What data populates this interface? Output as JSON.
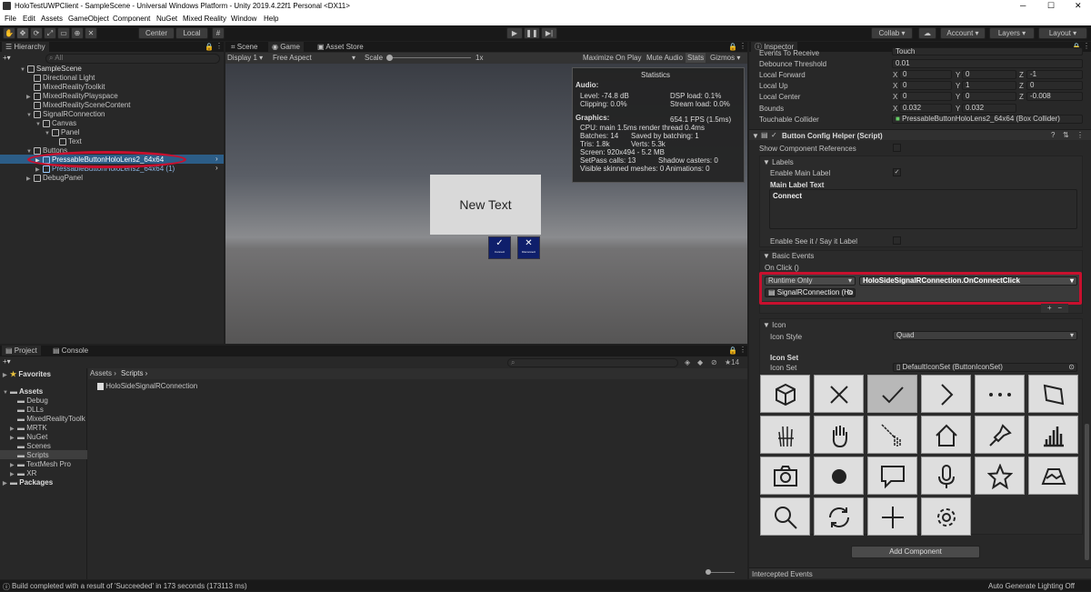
{
  "titlebar": {
    "title": "HoloTestUWPClient - SampleScene - Universal Windows Platform - Unity 2019.4.22f1 Personal <DX11>"
  },
  "menu": [
    "File",
    "Edit",
    "Assets",
    "GameObject",
    "Component",
    "NuGet",
    "Mixed Reality",
    "Window",
    "Help"
  ],
  "toolbar": {
    "center": "Center",
    "local": "Local",
    "collab": "Collab",
    "account": "Account",
    "layers": "Layers",
    "layout": "Layout"
  },
  "hierarchy": {
    "tab": "Hierarchy",
    "search_placeholder": "All",
    "items": [
      {
        "label": "SampleScene",
        "indent": 0
      },
      {
        "label": "Directional Light",
        "indent": 1
      },
      {
        "label": "MixedRealityToolkit",
        "indent": 1
      },
      {
        "label": "MixedRealityPlayspace",
        "indent": 1
      },
      {
        "label": "MixedRealitySceneContent",
        "indent": 1
      },
      {
        "label": "SignalRConnection",
        "indent": 1
      },
      {
        "label": "Canvas",
        "indent": 2
      },
      {
        "label": "Panel",
        "indent": 3
      },
      {
        "label": "Text",
        "indent": 4
      },
      {
        "label": "Buttons",
        "indent": 1
      },
      {
        "label": "PressableButtonHoloLens2_64x64",
        "indent": 2
      },
      {
        "label": "PressableButtonHoloLens2_64x64 (1)",
        "indent": 2
      },
      {
        "label": "DebugPanel",
        "indent": 1
      }
    ]
  },
  "game": {
    "tabs": [
      "Scene",
      "Game",
      "Asset Store"
    ],
    "display": "Display 1",
    "aspect": "Free Aspect",
    "scale_label": "Scale",
    "scale_value": "1x",
    "maximize": "Maximize On Play",
    "mute": "Mute Audio",
    "stats": "Stats",
    "gizmos": "Gizmos",
    "new_text": "New Text",
    "btn1": "Connect",
    "btn2": "Disconnect"
  },
  "stats_panel": {
    "title": "Statistics",
    "audio": "Audio:",
    "level": "Level: -74.8 dB",
    "clipping": "Clipping: 0.0%",
    "dsp": "DSP load: 0.1%",
    "stream": "Stream load: 0.0%",
    "graphics": "Graphics:",
    "fps": "654.1 FPS (1.5ms)",
    "cpu": "CPU: main 1.5ms  render thread 0.4ms",
    "batches": "Batches: 14",
    "saved": "Saved by batching: 1",
    "tris": "Tris: 1.8k",
    "verts": "Verts: 5.3k",
    "screen": "Screen: 920x494 - 5.2 MB",
    "setpass": "SetPass calls: 13",
    "shadow": "Shadow casters: 0",
    "skinned": "Visible skinned meshes: 0  Animations: 0"
  },
  "project": {
    "tabs": [
      "Project",
      "Console"
    ],
    "count": "14",
    "favorites": "Favorites",
    "assets": "Assets",
    "folders": [
      "Debug",
      "DLLs",
      "MixedRealityToolk",
      "MRTK",
      "NuGet",
      "Scenes",
      "Scripts",
      "TextMesh Pro",
      "XR"
    ],
    "packages": "Packages",
    "breadcrumb1": "Assets",
    "breadcrumb2": "Scripts",
    "file": "HoloSideSignalRConnection"
  },
  "inspector": {
    "tab": "Inspector",
    "events_to_receive": "Events To Receive",
    "events_value": "Touch",
    "debounce": "Debounce Threshold",
    "debounce_value": "0.01",
    "fwd": "Local Forward",
    "fwd_vals": [
      "0",
      "0",
      "-1"
    ],
    "up": "Local Up",
    "up_vals": [
      "0",
      "1",
      "0"
    ],
    "center": "Local Center",
    "center_vals": [
      "0",
      "0",
      "-0.008"
    ],
    "bounds": "Bounds",
    "bounds_vals": [
      "0.032",
      "0.032"
    ],
    "collider": "Touchable Collider",
    "collider_value": "PressableButtonHoloLens2_64x64 (Box Collider)",
    "component": "Button Config Helper (Script)",
    "show_refs": "Show Component References",
    "labels": "Labels",
    "enable_main": "Enable Main Label",
    "main_label_text": "Main Label Text",
    "main_label_value": "Connect",
    "enable_see": "Enable See it / Say it Label",
    "basic_events": "Basic Events",
    "onclick": "On Click ()",
    "runtime": "Runtime Only",
    "func": "HoloSideSignalRConnection.OnConnectClick",
    "target": "SignalRConnection (Ho",
    "icon": "Icon",
    "icon_style": "Icon Style",
    "icon_style_value": "Quad",
    "icon_set_hdr": "Icon Set",
    "icon_set": "Icon Set",
    "icon_set_value": "DefaultIconSet (ButtonIconSet)",
    "add_component": "Add Component",
    "intercepted": "Intercepted Events",
    "plus": "+",
    "minus": "−"
  },
  "status": {
    "build": "Build completed with a result of 'Succeeded' in 173 seconds (173113 ms)",
    "lighting": "Auto Generate Lighting Off"
  }
}
